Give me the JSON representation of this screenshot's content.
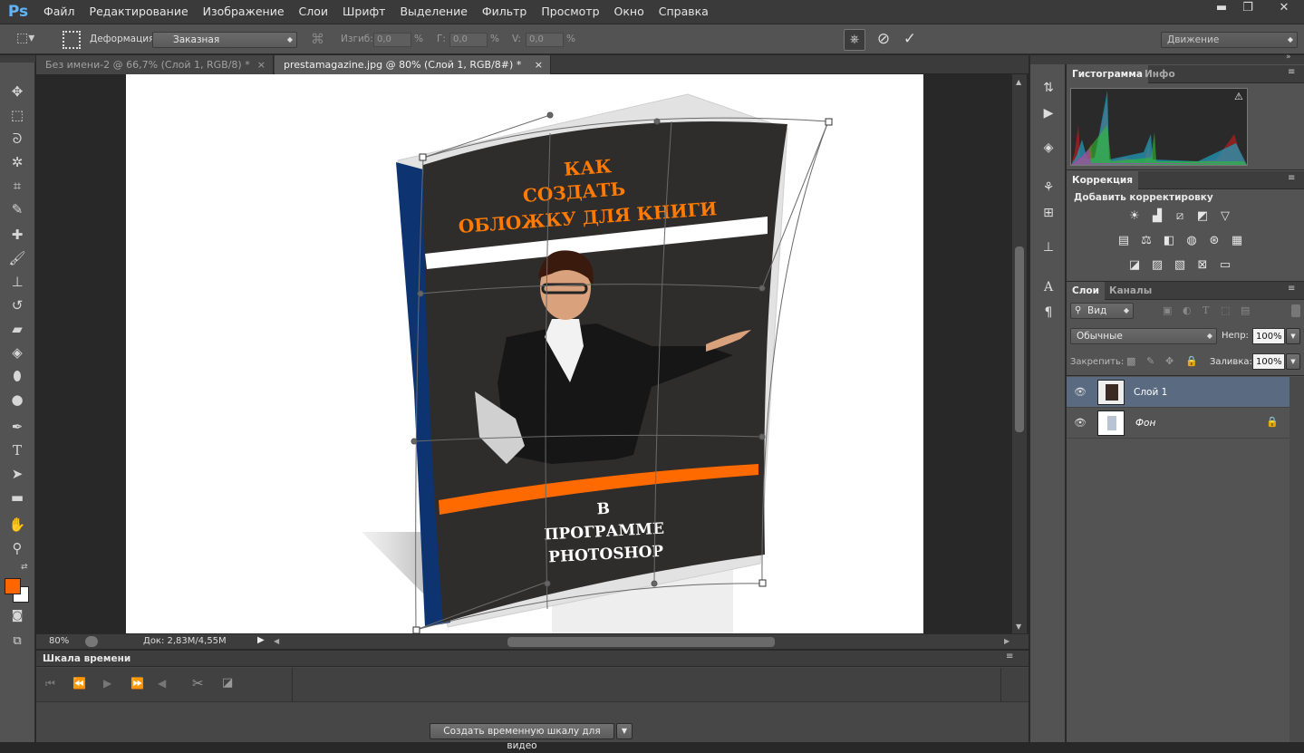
{
  "app": {
    "logo": "Ps"
  },
  "menu": [
    "Файл",
    "Редактирование",
    "Изображение",
    "Слои",
    "Шрифт",
    "Выделение",
    "Фильтр",
    "Просмотр",
    "Окно",
    "Справка"
  ],
  "window_controls": {
    "minimize": "▬",
    "restore": "❐",
    "close": "✕"
  },
  "options": {
    "deform_label": "Деформация:",
    "deform_value": "Заказная",
    "bend_label": "Изгиб:",
    "bend_value": "0,0",
    "bend_unit": "%",
    "h_label": "Г:",
    "h_value": "0,0",
    "h_unit": "%",
    "v_label": "V:",
    "v_value": "0,0",
    "v_unit": "%",
    "workspace": "Движение"
  },
  "tabs": [
    {
      "label": "Без имени-2 @ 66,7% (Слой 1, RGB/8) *",
      "close": "×"
    },
    {
      "label": "prestamagazine.jpg @ 80% (Слой 1, RGB/8#) *",
      "close": "×"
    }
  ],
  "book": {
    "title_lines": [
      "КАК",
      "СОЗДАТЬ",
      "ОБЛОЖКУ ДЛЯ КНИГИ"
    ],
    "sub_lines": [
      "В",
      "ПРОГРАММЕ",
      "PHOTOSHOP"
    ]
  },
  "status": {
    "zoom": "80%",
    "doc": "Док: 2,83M/4,55M"
  },
  "timeline": {
    "title": "Шкала времени",
    "create_button": "Создать временную шкалу для видео"
  },
  "histogram_panel": {
    "tabs": [
      "Гистограмма",
      "Инфо"
    ]
  },
  "adjustments_panel": {
    "tab": "Коррекция",
    "add_label": "Добавить корректировку"
  },
  "layers_panel": {
    "tabs": [
      "Слои",
      "Каналы"
    ],
    "filter": "Вид",
    "blend_mode": "Обычные",
    "opacity_label": "Непр:",
    "opacity_value": "100%",
    "lock_label": "Закрепить:",
    "fill_label": "Заливка:",
    "fill_value": "100%",
    "layers": [
      {
        "name": "Слой 1",
        "selected": true
      },
      {
        "name": "Фон",
        "selected": false
      }
    ]
  },
  "colors": {
    "foreground": "#ff6600",
    "background": "#ffffff",
    "selection": "#5a6a80"
  }
}
